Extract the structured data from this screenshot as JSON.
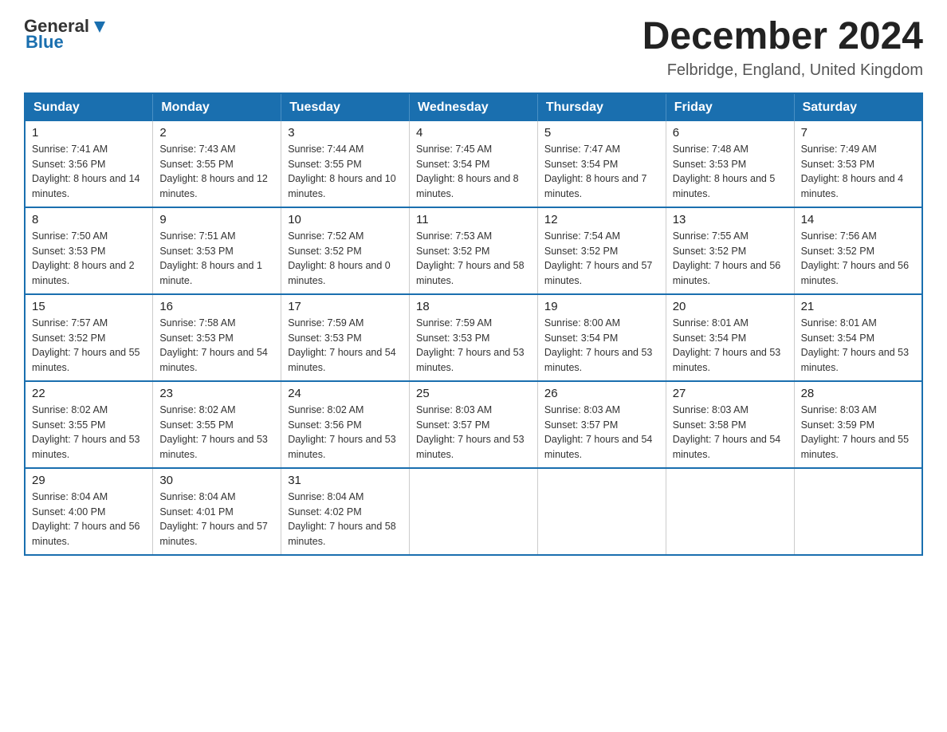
{
  "header": {
    "logo": {
      "general": "General",
      "blue": "Blue"
    },
    "title": "December 2024",
    "location": "Felbridge, England, United Kingdom"
  },
  "days_of_week": [
    "Sunday",
    "Monday",
    "Tuesday",
    "Wednesday",
    "Thursday",
    "Friday",
    "Saturday"
  ],
  "weeks": [
    [
      {
        "day": "1",
        "sunrise": "7:41 AM",
        "sunset": "3:56 PM",
        "daylight": "8 hours and 14 minutes."
      },
      {
        "day": "2",
        "sunrise": "7:43 AM",
        "sunset": "3:55 PM",
        "daylight": "8 hours and 12 minutes."
      },
      {
        "day": "3",
        "sunrise": "7:44 AM",
        "sunset": "3:55 PM",
        "daylight": "8 hours and 10 minutes."
      },
      {
        "day": "4",
        "sunrise": "7:45 AM",
        "sunset": "3:54 PM",
        "daylight": "8 hours and 8 minutes."
      },
      {
        "day": "5",
        "sunrise": "7:47 AM",
        "sunset": "3:54 PM",
        "daylight": "8 hours and 7 minutes."
      },
      {
        "day": "6",
        "sunrise": "7:48 AM",
        "sunset": "3:53 PM",
        "daylight": "8 hours and 5 minutes."
      },
      {
        "day": "7",
        "sunrise": "7:49 AM",
        "sunset": "3:53 PM",
        "daylight": "8 hours and 4 minutes."
      }
    ],
    [
      {
        "day": "8",
        "sunrise": "7:50 AM",
        "sunset": "3:53 PM",
        "daylight": "8 hours and 2 minutes."
      },
      {
        "day": "9",
        "sunrise": "7:51 AM",
        "sunset": "3:53 PM",
        "daylight": "8 hours and 1 minute."
      },
      {
        "day": "10",
        "sunrise": "7:52 AM",
        "sunset": "3:52 PM",
        "daylight": "8 hours and 0 minutes."
      },
      {
        "day": "11",
        "sunrise": "7:53 AM",
        "sunset": "3:52 PM",
        "daylight": "7 hours and 58 minutes."
      },
      {
        "day": "12",
        "sunrise": "7:54 AM",
        "sunset": "3:52 PM",
        "daylight": "7 hours and 57 minutes."
      },
      {
        "day": "13",
        "sunrise": "7:55 AM",
        "sunset": "3:52 PM",
        "daylight": "7 hours and 56 minutes."
      },
      {
        "day": "14",
        "sunrise": "7:56 AM",
        "sunset": "3:52 PM",
        "daylight": "7 hours and 56 minutes."
      }
    ],
    [
      {
        "day": "15",
        "sunrise": "7:57 AM",
        "sunset": "3:52 PM",
        "daylight": "7 hours and 55 minutes."
      },
      {
        "day": "16",
        "sunrise": "7:58 AM",
        "sunset": "3:53 PM",
        "daylight": "7 hours and 54 minutes."
      },
      {
        "day": "17",
        "sunrise": "7:59 AM",
        "sunset": "3:53 PM",
        "daylight": "7 hours and 54 minutes."
      },
      {
        "day": "18",
        "sunrise": "7:59 AM",
        "sunset": "3:53 PM",
        "daylight": "7 hours and 53 minutes."
      },
      {
        "day": "19",
        "sunrise": "8:00 AM",
        "sunset": "3:54 PM",
        "daylight": "7 hours and 53 minutes."
      },
      {
        "day": "20",
        "sunrise": "8:01 AM",
        "sunset": "3:54 PM",
        "daylight": "7 hours and 53 minutes."
      },
      {
        "day": "21",
        "sunrise": "8:01 AM",
        "sunset": "3:54 PM",
        "daylight": "7 hours and 53 minutes."
      }
    ],
    [
      {
        "day": "22",
        "sunrise": "8:02 AM",
        "sunset": "3:55 PM",
        "daylight": "7 hours and 53 minutes."
      },
      {
        "day": "23",
        "sunrise": "8:02 AM",
        "sunset": "3:55 PM",
        "daylight": "7 hours and 53 minutes."
      },
      {
        "day": "24",
        "sunrise": "8:02 AM",
        "sunset": "3:56 PM",
        "daylight": "7 hours and 53 minutes."
      },
      {
        "day": "25",
        "sunrise": "8:03 AM",
        "sunset": "3:57 PM",
        "daylight": "7 hours and 53 minutes."
      },
      {
        "day": "26",
        "sunrise": "8:03 AM",
        "sunset": "3:57 PM",
        "daylight": "7 hours and 54 minutes."
      },
      {
        "day": "27",
        "sunrise": "8:03 AM",
        "sunset": "3:58 PM",
        "daylight": "7 hours and 54 minutes."
      },
      {
        "day": "28",
        "sunrise": "8:03 AM",
        "sunset": "3:59 PM",
        "daylight": "7 hours and 55 minutes."
      }
    ],
    [
      {
        "day": "29",
        "sunrise": "8:04 AM",
        "sunset": "4:00 PM",
        "daylight": "7 hours and 56 minutes."
      },
      {
        "day": "30",
        "sunrise": "8:04 AM",
        "sunset": "4:01 PM",
        "daylight": "7 hours and 57 minutes."
      },
      {
        "day": "31",
        "sunrise": "8:04 AM",
        "sunset": "4:02 PM",
        "daylight": "7 hours and 58 minutes."
      },
      null,
      null,
      null,
      null
    ]
  ]
}
